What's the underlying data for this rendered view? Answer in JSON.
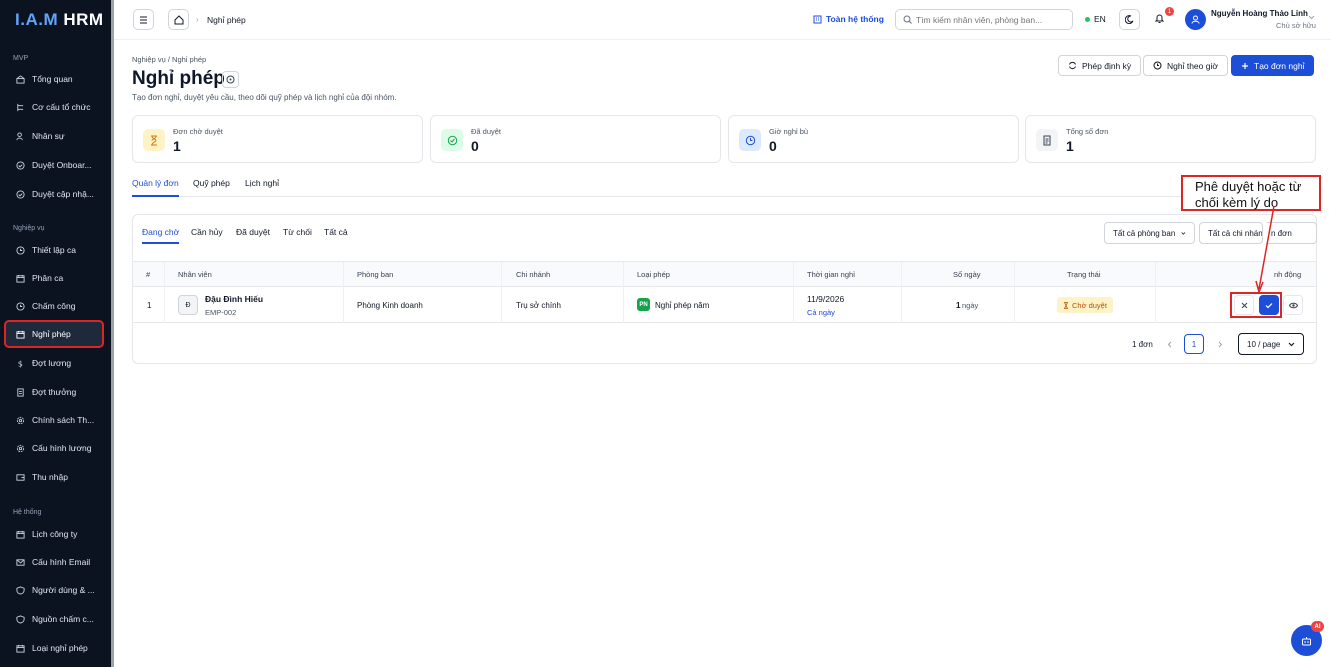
{
  "app": {
    "logo_text": "I.A.M HRM"
  },
  "sidebar": {
    "sections": [
      {
        "title": "MVP",
        "items": [
          {
            "label": "Tổng quan",
            "icon": "dashboard-icon"
          },
          {
            "label": "Cơ cấu tổ chức",
            "icon": "org-chart-icon"
          },
          {
            "label": "Nhân sự",
            "icon": "users-icon"
          },
          {
            "label": "Duyệt Onboar...",
            "icon": "check-circle-icon"
          },
          {
            "label": "Duyệt cập nhậ...",
            "icon": "check-circle-icon"
          }
        ]
      },
      {
        "title": "Nghiệp vụ",
        "items": [
          {
            "label": "Thiết lập ca",
            "icon": "clock-icon"
          },
          {
            "label": "Phân ca",
            "icon": "calendar-icon"
          },
          {
            "label": "Chấm công",
            "icon": "clock-icon"
          },
          {
            "label": "Nghỉ phép",
            "icon": "calendar-icon",
            "active": true
          },
          {
            "label": "Đợt lương",
            "icon": "dollar-icon"
          },
          {
            "label": "Đợt thưởng",
            "icon": "document-icon"
          },
          {
            "label": "Chính sách Th...",
            "icon": "settings-icon"
          },
          {
            "label": "Cấu hình lương",
            "icon": "settings-icon"
          },
          {
            "label": "Thu nhập",
            "icon": "wallet-icon"
          }
        ]
      },
      {
        "title": "Hệ thống",
        "items": [
          {
            "label": "Lịch công ty",
            "icon": "calendar-icon"
          },
          {
            "label": "Cấu hình Email",
            "icon": "mail-icon"
          },
          {
            "label": "Người dùng & ...",
            "icon": "shield-icon"
          },
          {
            "label": "Nguồn chấm c...",
            "icon": "shield-icon"
          },
          {
            "label": "Loại nghỉ phép",
            "icon": "calendar-icon"
          }
        ]
      }
    ]
  },
  "topbar": {
    "breadcrumb_current": "Nghỉ phép",
    "system_label": "Toàn hệ thống",
    "search_placeholder": "Tìm kiếm nhân viên, phòng ban...",
    "language": "EN",
    "notification_count": "1",
    "user_name": "Nguyễn Hoàng Thảo Linh",
    "user_role": "Chủ sở hữu"
  },
  "page": {
    "breadcrumb": "Nghiệp vụ / Nghỉ phép",
    "title": "Nghỉ phép",
    "subtitle": "Tạo đơn nghỉ, duyệt yêu cầu, theo dõi quỹ phép và lịch nghỉ của đội nhóm.",
    "buttons": {
      "periodic": "Phép định kỳ",
      "hourly": "Nghỉ theo giờ",
      "create": "Tạo đơn nghỉ"
    }
  },
  "stats": [
    {
      "label": "Đơn chờ duyệt",
      "value": "1",
      "icon": "hourglass-icon",
      "color": "#d97706",
      "bg": "#fef3c7"
    },
    {
      "label": "Đã duyệt",
      "value": "0",
      "icon": "check-circle-icon",
      "color": "#16a34a",
      "bg": "#dcfce7"
    },
    {
      "label": "Giờ nghỉ bù",
      "value": "0",
      "icon": "clock-icon",
      "color": "#1d4ed8",
      "bg": "#dbeafe"
    },
    {
      "label": "Tổng số đơn",
      "value": "1",
      "icon": "document-icon",
      "color": "#374151",
      "bg": "#f3f4f6"
    }
  ],
  "tabs": [
    "Quản lý đơn",
    "Quỹ phép",
    "Lịch nghỉ"
  ],
  "subtabs": [
    "Đang chờ",
    "Cần hủy",
    "Đã duyệt",
    "Từ chối",
    "Tất cả"
  ],
  "filters": {
    "department": "Tất cả phòng ban",
    "branch": "Tất cả chi nhánh",
    "extra": "n đơn"
  },
  "table": {
    "headers": [
      "#",
      "Nhân viên",
      "Phòng ban",
      "Chi nhánh",
      "Loại phép",
      "Thời gian nghỉ",
      "Số ngày",
      "Trạng thái",
      "Hành động"
    ],
    "visible_header_last": "nh động",
    "rows": [
      {
        "index": "1",
        "avatar_initial": "Đ",
        "employee_name": "Đậu Đình Hiếu",
        "employee_code": "EMP-002",
        "department": "Phòng Kinh doanh",
        "branch": "Trụ sở chính",
        "leave_type_badge": "PN",
        "leave_type": "Nghỉ phép năm",
        "date": "11/9/2026",
        "duration_type": "Cả ngày",
        "days": "1",
        "days_unit": "ngày",
        "status": "Chờ duyệt"
      }
    ]
  },
  "pagination": {
    "count": "1 đơn",
    "current_page": "1",
    "page_size": "10 / page"
  },
  "annotation": {
    "text": "Phê duyệt hoặc từ chối kèm lý do"
  },
  "ai_button": {
    "badge": "AI"
  },
  "colors": {
    "primary": "#1d4ed8",
    "sidebar_bg": "#0b1220",
    "highlight": "#dc2626"
  }
}
